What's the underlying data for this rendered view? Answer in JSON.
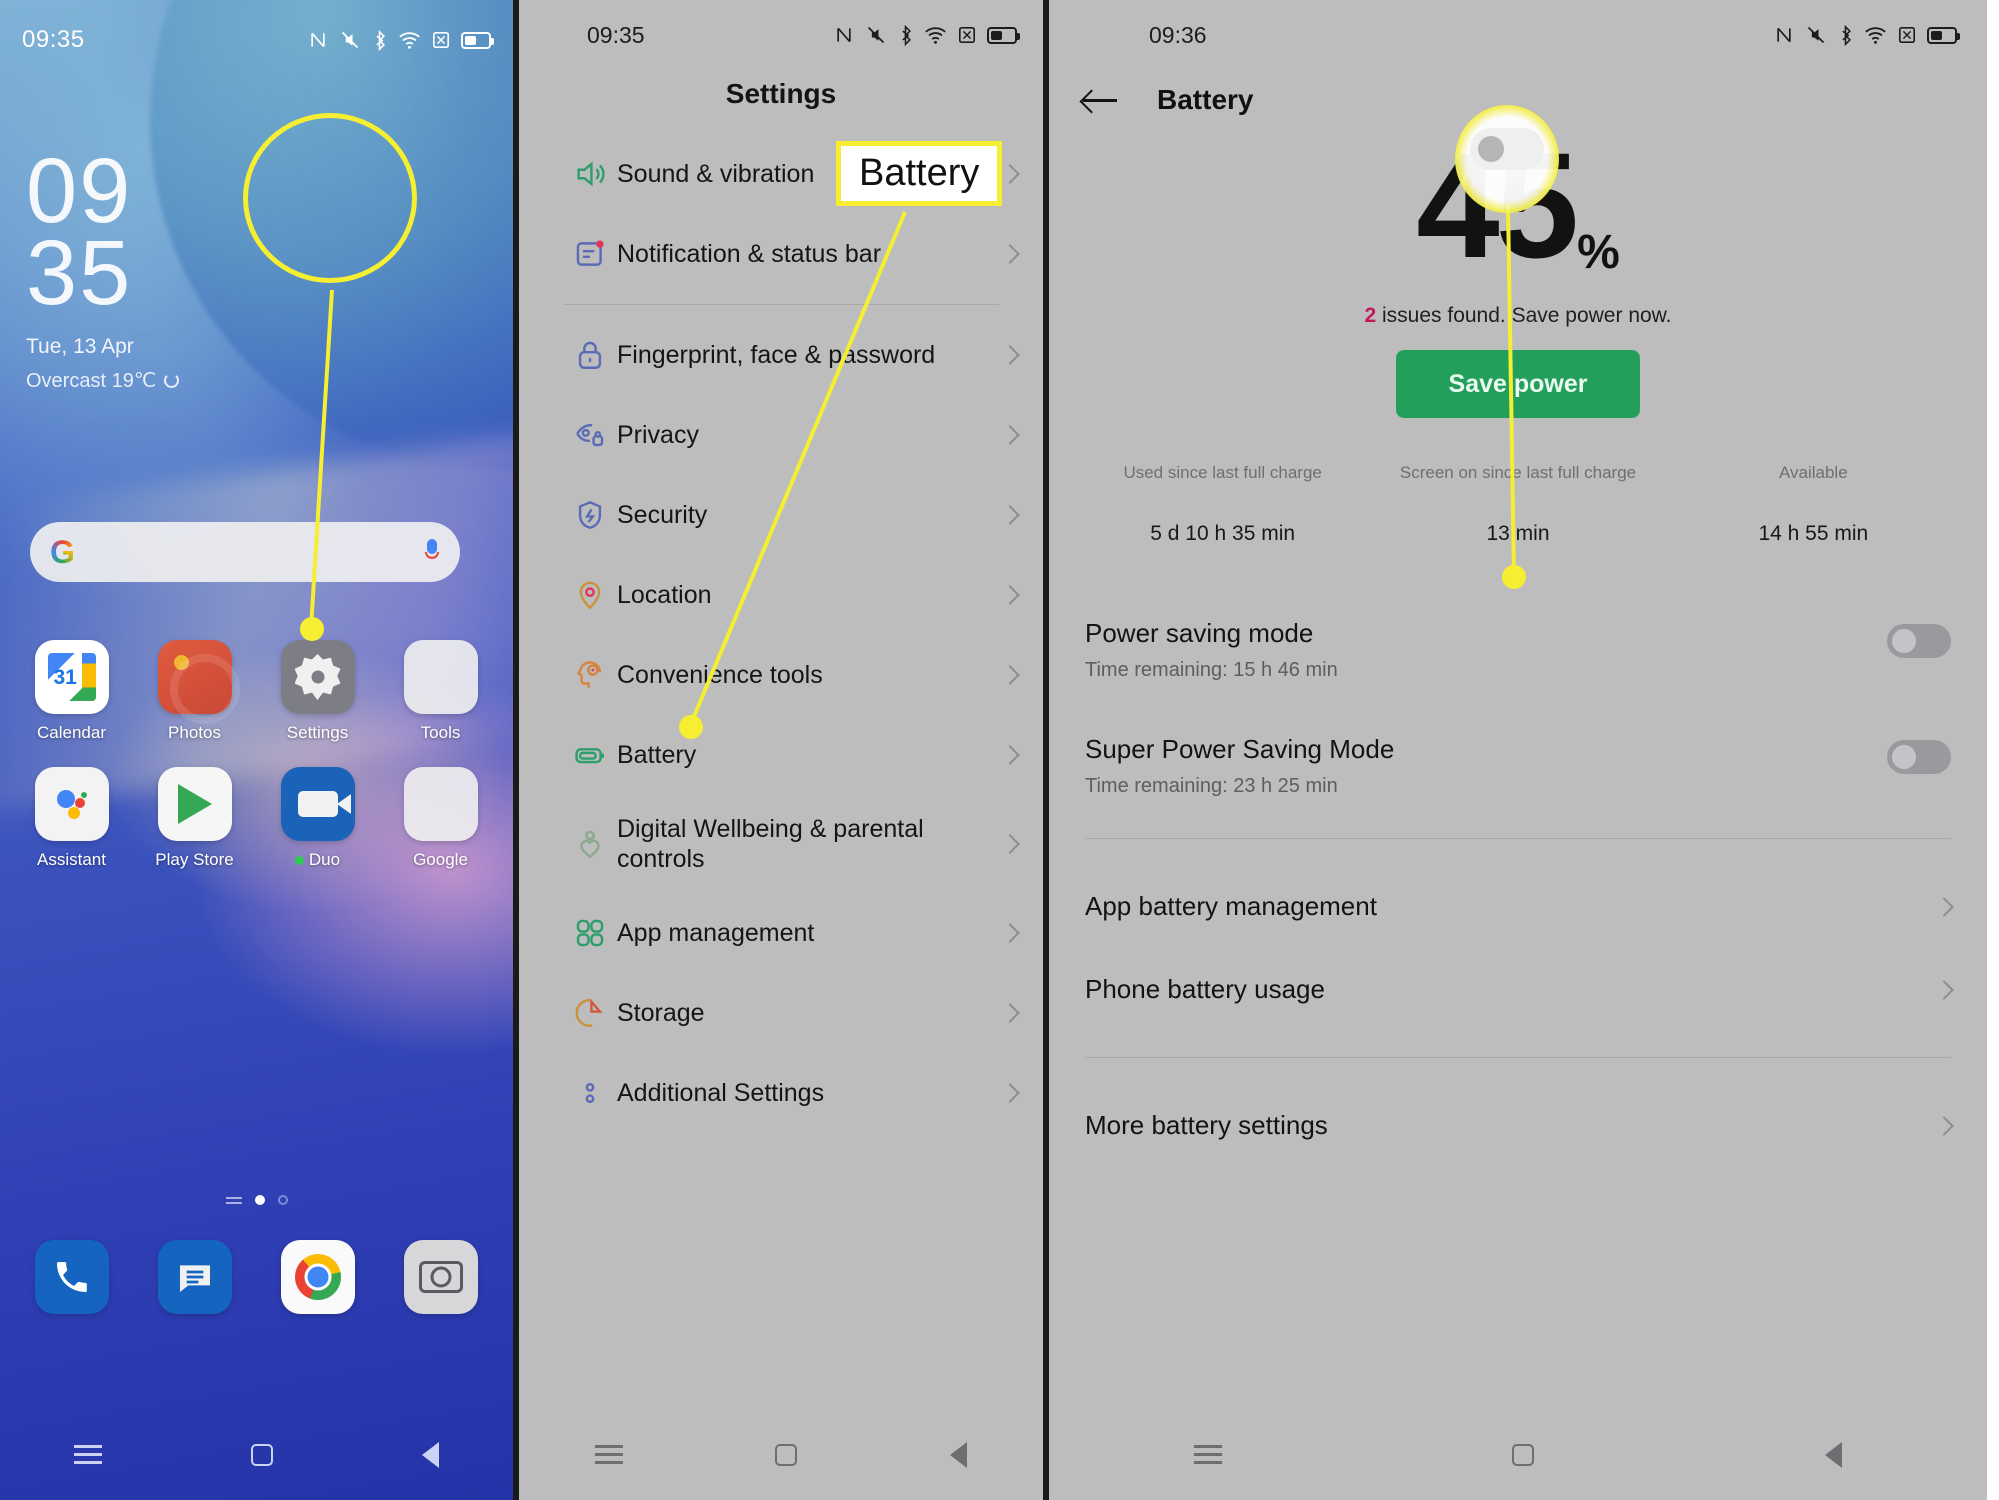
{
  "home": {
    "status": {
      "time": "09:35",
      "icons": [
        "nfc-icon",
        "mute-icon",
        "bluetooth-icon",
        "wifi-icon",
        "sim-x-icon",
        "battery-icon"
      ]
    },
    "clock": {
      "hours": "09",
      "minutes": "35"
    },
    "date": "Tue, 13 Apr",
    "weather": "Overcast 19℃",
    "search": {
      "logo": "google-g-logo",
      "mic": "microphone-icon"
    },
    "apps_row1": [
      {
        "label": "Calendar",
        "icon": "calendar-icon"
      },
      {
        "label": "Photos",
        "icon": "photos-icon"
      },
      {
        "label": "Settings",
        "icon": "settings-gear-icon"
      },
      {
        "label": "Tools",
        "icon": "tools-folder-icon"
      }
    ],
    "apps_row2": [
      {
        "label": "Assistant",
        "icon": "google-assistant-icon"
      },
      {
        "label": "Play Store",
        "icon": "play-store-icon"
      },
      {
        "label": "Duo",
        "icon": "google-duo-icon",
        "badge_dot": true
      },
      {
        "label": "Google",
        "icon": "google-folder-icon"
      }
    ],
    "dock": [
      {
        "label": "Phone",
        "icon": "phone-icon"
      },
      {
        "label": "Messages",
        "icon": "messages-icon"
      },
      {
        "label": "Chrome",
        "icon": "chrome-icon"
      },
      {
        "label": "Camera",
        "icon": "camera-icon"
      }
    ],
    "navbar": [
      "recents-icon",
      "home-icon",
      "back-icon"
    ]
  },
  "settings": {
    "status": {
      "time": "09:35"
    },
    "title": "Settings",
    "items_top": [
      {
        "label": "Sound & vibration",
        "icon": "speaker-icon"
      },
      {
        "label": "Notification & status bar",
        "icon": "notification-icon"
      }
    ],
    "items_main": [
      {
        "label": "Fingerprint, face & password",
        "icon": "lock-icon"
      },
      {
        "label": "Privacy",
        "icon": "privacy-eye-icon"
      },
      {
        "label": "Security",
        "icon": "shield-bolt-icon"
      },
      {
        "label": "Location",
        "icon": "location-pin-icon"
      },
      {
        "label": "Convenience tools",
        "icon": "convenience-head-icon"
      },
      {
        "label": "Battery",
        "icon": "battery-outline-icon"
      },
      {
        "label": "Digital Wellbeing & parental controls",
        "icon": "wellbeing-heart-icon"
      },
      {
        "label": "App management",
        "icon": "app-grid-icon"
      },
      {
        "label": "Storage",
        "icon": "storage-pie-icon"
      },
      {
        "label": "Additional Settings",
        "icon": "additional-dots-icon"
      }
    ],
    "navbar": [
      "recents-icon",
      "home-icon",
      "back-icon"
    ]
  },
  "battery": {
    "status": {
      "time": "09:36"
    },
    "title": "Battery",
    "percent": "45",
    "percent_symbol": "%",
    "issues_count": "2",
    "issues_text": " issues found. Save power now.",
    "save_power_label": "Save power",
    "stats": [
      {
        "label": "Used since last full charge",
        "value": "5 d 10 h 35 min"
      },
      {
        "label": "Screen on since last full charge",
        "value": "13 min"
      },
      {
        "label": "Available",
        "value": "14 h 55 min"
      }
    ],
    "toggles": [
      {
        "name": "Power saving mode",
        "sub": "Time remaining:  15 h 46 min",
        "state": "off"
      },
      {
        "name": "Super Power Saving Mode",
        "sub": "Time remaining:  23 h 25 min",
        "state": "off"
      }
    ],
    "links": [
      {
        "label": "App battery management"
      },
      {
        "label": "Phone battery usage"
      },
      {
        "label": "More battery settings"
      }
    ],
    "navbar": [
      "recents-icon",
      "home-icon",
      "back-icon"
    ]
  },
  "annotations": {
    "callout_label": "Battery",
    "accent_color": "#f5ee31",
    "highlight_targets": [
      "settings-app-icon",
      "battery-list-item",
      "power-saving-toggle"
    ]
  }
}
